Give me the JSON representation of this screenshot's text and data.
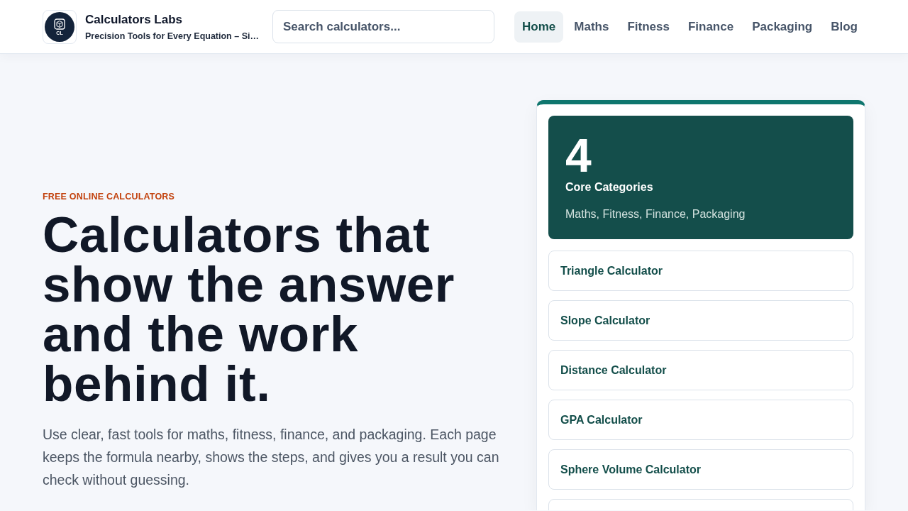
{
  "header": {
    "logo": {
      "text": "CL"
    },
    "title": "Calculators Labs",
    "subtitle": "Precision Tools for Every Equation – Si…",
    "search": {
      "placeholder": "Search calculators..."
    },
    "nav": [
      {
        "label": "Home",
        "selected": true
      },
      {
        "label": "Maths",
        "selected": false
      },
      {
        "label": "Fitness",
        "selected": false
      },
      {
        "label": "Finance",
        "selected": false
      },
      {
        "label": "Packaging",
        "selected": false
      },
      {
        "label": "Blog",
        "selected": false
      }
    ]
  },
  "hero": {
    "eyebrow": "FREE ONLINE CALCULATORS",
    "heading": "Calculators that show the answer and the work behind it.",
    "description": "Use clear, fast tools for maths, fitness, finance, and packaging. Each page keeps the formula nearby, shows the steps, and gives you a result you can check without guessing."
  },
  "sidebar": {
    "stat": {
      "value": "4",
      "label": "Core Categories",
      "detail": "Maths, Fitness, Finance, Packaging"
    },
    "links": [
      "Triangle Calculator",
      "Slope Calculator",
      "Distance Calculator",
      "GPA Calculator",
      "Sphere Volume Calculator"
    ]
  }
}
